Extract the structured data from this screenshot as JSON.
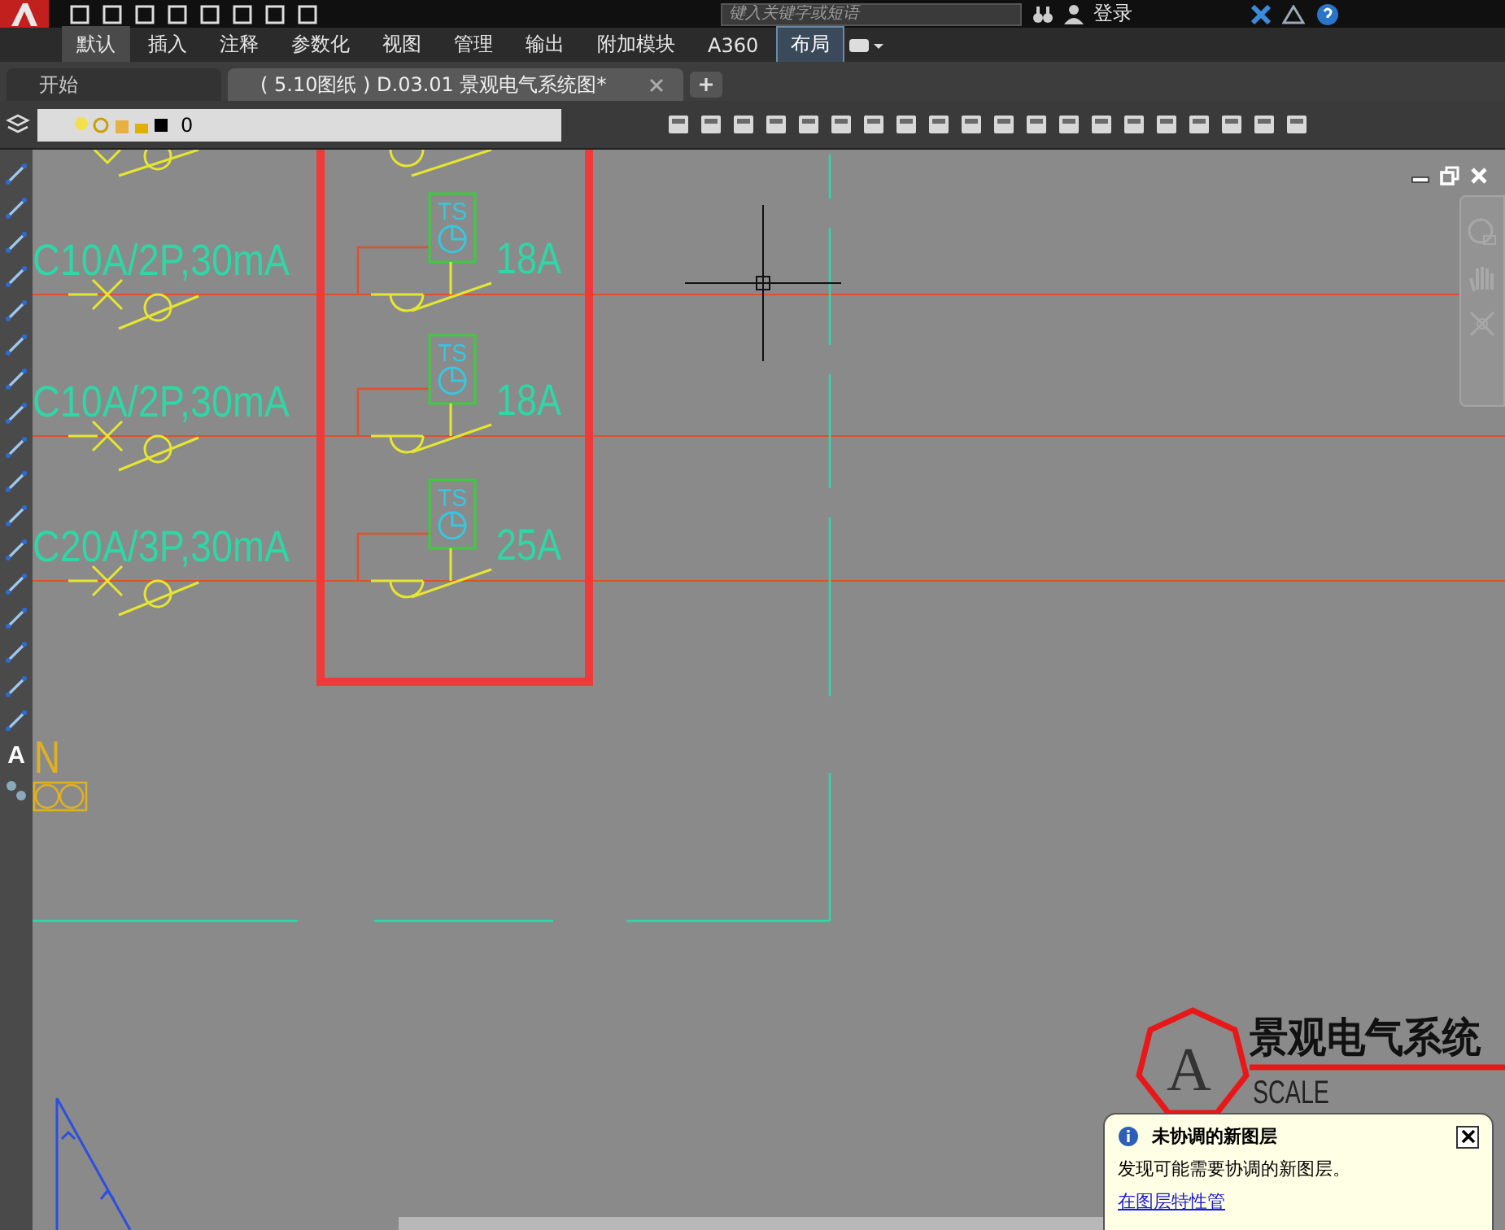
{
  "ribbon": {
    "search": {
      "placeholder": "键入关键字或短语"
    },
    "login": "登录",
    "tabs": [
      {
        "label": "默认",
        "selected": true,
        "kind": "normal"
      },
      {
        "label": "插入",
        "selected": false,
        "kind": "normal"
      },
      {
        "label": "注释",
        "selected": false,
        "kind": "normal"
      },
      {
        "label": "参数化",
        "selected": false,
        "kind": "normal"
      },
      {
        "label": "视图",
        "selected": false,
        "kind": "normal"
      },
      {
        "label": "管理",
        "selected": false,
        "kind": "normal"
      },
      {
        "label": "输出",
        "selected": false,
        "kind": "normal"
      },
      {
        "label": "附加模块",
        "selected": false,
        "kind": "normal"
      },
      {
        "label": "A360",
        "selected": false,
        "kind": "normal"
      },
      {
        "label": "布局",
        "selected": false,
        "kind": "contextual"
      }
    ]
  },
  "file_tabs": [
    {
      "label": "开始",
      "selected": false,
      "closable": false
    },
    {
      "label": "( 5.10图纸 ) D.03.01 景观电气系统图*",
      "selected": true,
      "closable": true
    }
  ],
  "layer_control": {
    "value": "0"
  },
  "left_toolbar": {
    "text_tool": "A"
  },
  "drawing": {
    "circuits": [
      {
        "breaker": "C10A/2P,30mA",
        "timer": "TS",
        "rating": "18A"
      },
      {
        "breaker": "C10A/2P,30mA",
        "timer": "TS",
        "rating": "18A"
      },
      {
        "breaker": "C20A/3P,30mA",
        "timer": "TS",
        "rating": "25A"
      }
    ],
    "neutral_label": "N",
    "title_block": {
      "symbol": "A",
      "title": "景观电气系统",
      "scale": "SCALE"
    }
  },
  "notification": {
    "title": "未协调的新图层",
    "message": "发现可能需要协调的新图层。",
    "link": "在图层特性管"
  }
}
